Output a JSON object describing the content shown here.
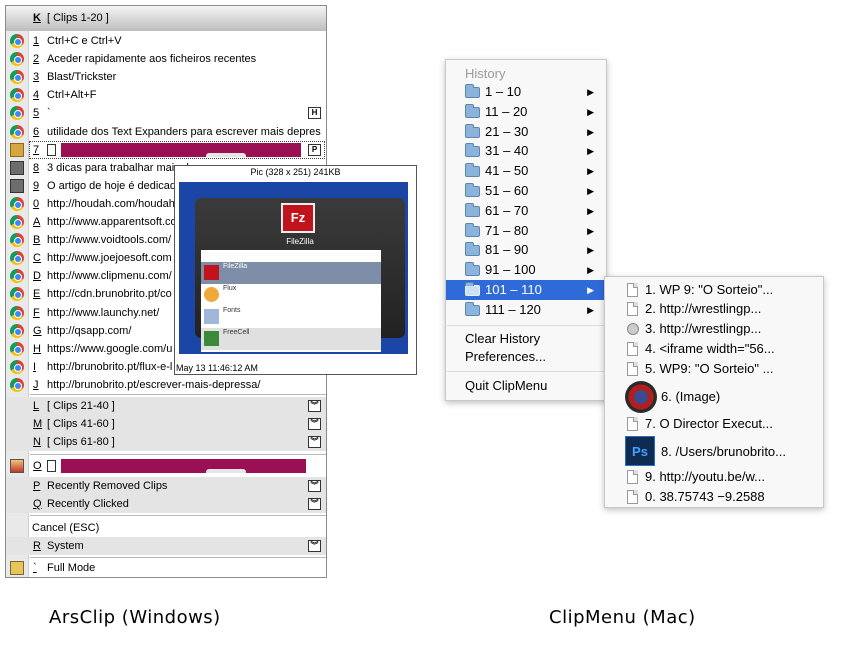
{
  "arsclip": {
    "header": {
      "key": "K",
      "label": "[ Clips 1-20 ]"
    },
    "clips": [
      {
        "key": "1",
        "text": "Ctrl+C e Ctrl+V",
        "icon": "chrome-icon"
      },
      {
        "key": "2",
        "text": "Aceder rapidamente aos ficheiros recentes",
        "icon": "chrome-icon"
      },
      {
        "key": "3",
        "text": "Blast/Trickster",
        "icon": "chrome-icon"
      },
      {
        "key": "4",
        "text": "Ctrl+Alt+F",
        "icon": "chrome-icon"
      },
      {
        "key": "5",
        "text": "`",
        "icon": "chrome-icon",
        "badge": "H"
      },
      {
        "key": "6",
        "text": "utilidade dos Text Expanders para escrever mais depres",
        "icon": "chrome-icon"
      },
      {
        "key": "7",
        "text": "",
        "icon": "folder-icon",
        "badge": "P"
      },
      {
        "key": "8",
        "text": "3 dicas para trabalhar mais depressa",
        "icon": "picture-icon"
      },
      {
        "key": "9",
        "text": "O artigo de hoje é dedicado",
        "icon": "picture-icon"
      },
      {
        "key": "0",
        "text": "http://houdah.com/houdahS",
        "icon": "chrome-icon"
      },
      {
        "key": "A",
        "text": "http://www.apparentsoft.co",
        "icon": "chrome-icon"
      },
      {
        "key": "B",
        "text": "http://www.voidtools.com/",
        "icon": "chrome-icon"
      },
      {
        "key": "C",
        "text": "http://www.joejoesoft.com",
        "icon": "chrome-icon"
      },
      {
        "key": "D",
        "text": "http://www.clipmenu.com/",
        "icon": "chrome-icon"
      },
      {
        "key": "E",
        "text": "http://cdn.brunobrito.pt/co",
        "icon": "chrome-icon"
      },
      {
        "key": "F",
        "text": "http://www.launchy.net/",
        "icon": "chrome-icon"
      },
      {
        "key": "G",
        "text": "http://qsapp.com/",
        "icon": "chrome-icon"
      },
      {
        "key": "H",
        "text": "https://www.google.com/u",
        "icon": "chrome-icon"
      },
      {
        "key": "I",
        "text": "http://brunobrito.pt/flux-e-l",
        "icon": "chrome-icon"
      },
      {
        "key": "J",
        "text": "http://brunobrito.pt/escrever-mais-depressa/",
        "icon": "chrome-icon"
      }
    ],
    "groups": [
      {
        "key": "L",
        "label": "[ Clips 21-40 ]"
      },
      {
        "key": "M",
        "label": "[ Clips 41-60 ]"
      },
      {
        "key": "N",
        "label": "[ Clips 61-80 ]"
      }
    ],
    "pinned": {
      "key": "O"
    },
    "extra": [
      {
        "key": "P",
        "label": "Recently Removed Clips"
      },
      {
        "key": "Q",
        "label": "Recently Clicked"
      }
    ],
    "cancel": "Cancel   (ESC)",
    "system": {
      "key": "R",
      "label": "System"
    },
    "fullmode": {
      "key": "`",
      "label": "Full Mode"
    },
    "preview": {
      "title": "Pic (328 x 251) 241KB",
      "footer": "May 13 11:46:12 AM",
      "app_name": "FileZilla",
      "logo": "Fz",
      "rows": [
        "FileZilla",
        "Flux",
        "Fonts",
        "FreeCell"
      ]
    }
  },
  "clipmenu": {
    "history_label": "History",
    "ranges": [
      "1 – 10",
      "11 – 20",
      "21 – 30",
      "31 – 40",
      "41 – 50",
      "51 – 60",
      "61 – 70",
      "71 – 80",
      "81 – 90",
      "91 – 100",
      "101 – 110",
      "111 – 120"
    ],
    "clear_history": "Clear History",
    "preferences": "Preferences...",
    "quit": "Quit ClipMenu",
    "submenu": [
      "1. WP 9: \"O Sorteio\"...",
      "2. http://wrestlingp...",
      "3. http://wrestlingp...",
      "4. <iframe width=\"56...",
      "5. WP9: \"O Sorteio\" ...",
      "6. (Image)",
      "7. O Director Execut...",
      "8. /Users/brunobrito...",
      "9. http://youtu.be/w...",
      "0. 38.75743 −9.2588"
    ]
  },
  "captions": {
    "left": "ArsClip (Windows)",
    "right": "ClipMenu (Mac)"
  }
}
